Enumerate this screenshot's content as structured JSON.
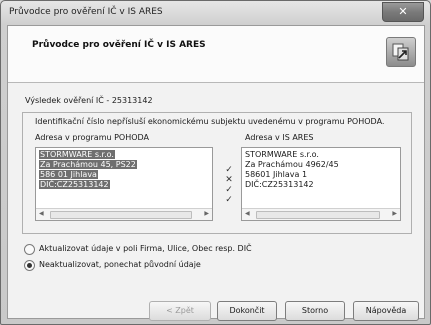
{
  "window": {
    "title": "Průvodce pro ověření IČ v IS ARES",
    "close_glyph": "✕"
  },
  "header": {
    "title": "Průvodce pro ověření IČ v IS ARES",
    "logo_icon": "ares-wizard-icon"
  },
  "result_label": "Výsledek ověření IČ - 25313142",
  "group": {
    "message": "Identifikační číslo nepřísluší ekonomickému subjektu uvedenému v programu POHODA.",
    "left_header": "Adresa v programu POHODA",
    "right_header": "Adresa v IS ARES",
    "pohoda_address": [
      "STORMWARE s.r.o.",
      "Za Prachámou 45, PS22",
      "586 01  Jihlava",
      "DIČ:CZ25313142"
    ],
    "ares_address": [
      "STORMWARE s.r.o.",
      "Za Prachámou 4962/45",
      "58601  Jihlava 1",
      "DIČ:CZ25313142"
    ],
    "marks": [
      "✓",
      "✕",
      "✓",
      "✓"
    ]
  },
  "options": {
    "update": "Aktualizovat údaje v poli Firma, Ulice, Obec resp. DIČ",
    "no_update": "Neaktualizovat, ponechat původní údaje",
    "selected": "no_update"
  },
  "buttons": {
    "back": "< Zpět",
    "finish": "Dokončit",
    "cancel": "Storno",
    "help": "Nápověda"
  }
}
